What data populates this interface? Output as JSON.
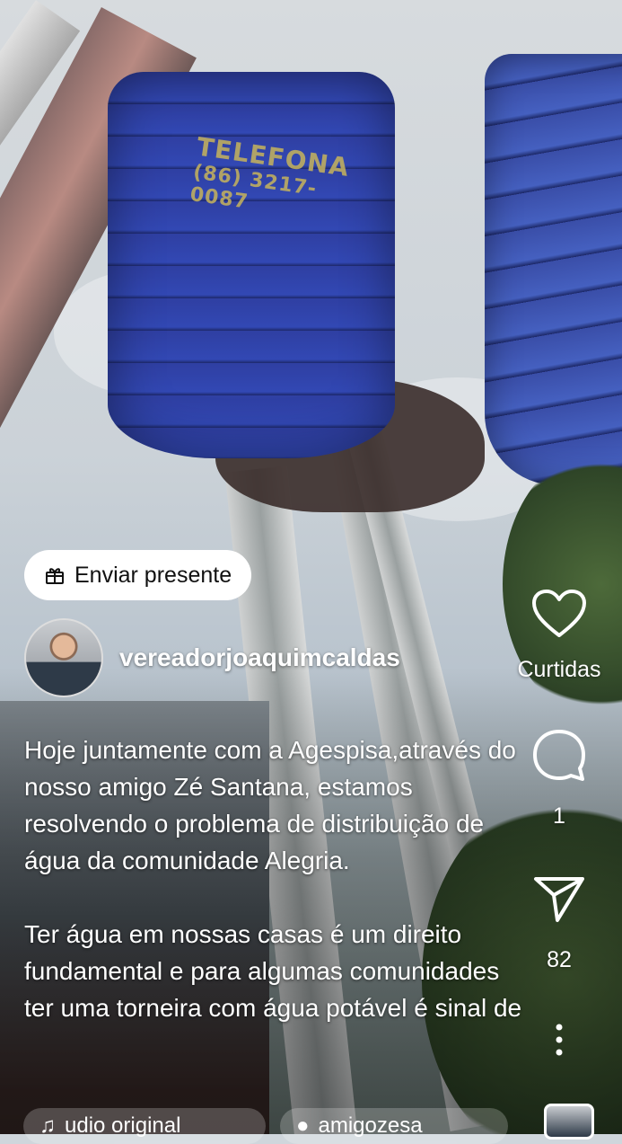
{
  "gift_button": {
    "label": "Enviar presente",
    "icon": "gift-icon"
  },
  "post": {
    "username": "vereadorjoaquimcaldas",
    "caption_paragraphs": [
      "Hoje juntamente com a Agespisa,através do nosso amigo Zé Santana, estamos resolvendo o problema de distribuição de água da comunidade Alegria.",
      "Ter água em nossas casas é um direito fundamental e para algumas comunidades ter uma torneira com água potável é sinal de"
    ],
    "tank_text_line1": "TELEFONA",
    "tank_text_line2": "(86) 3217-0087"
  },
  "actions": {
    "like": {
      "icon": "heart-icon",
      "label": "Curtidas"
    },
    "comment": {
      "icon": "comment-icon",
      "count": "1"
    },
    "share": {
      "icon": "send-icon",
      "count": "82"
    },
    "more": {
      "icon": "more-vertical-icon"
    }
  },
  "bottom": {
    "audio_label": "udio original",
    "user_label": "amigozesa",
    "audio_icon": "music-note-icon",
    "user_icon": "person-icon"
  },
  "colors": {
    "overlay_text": "#ffffff",
    "pill_bg": "#ffffff"
  }
}
